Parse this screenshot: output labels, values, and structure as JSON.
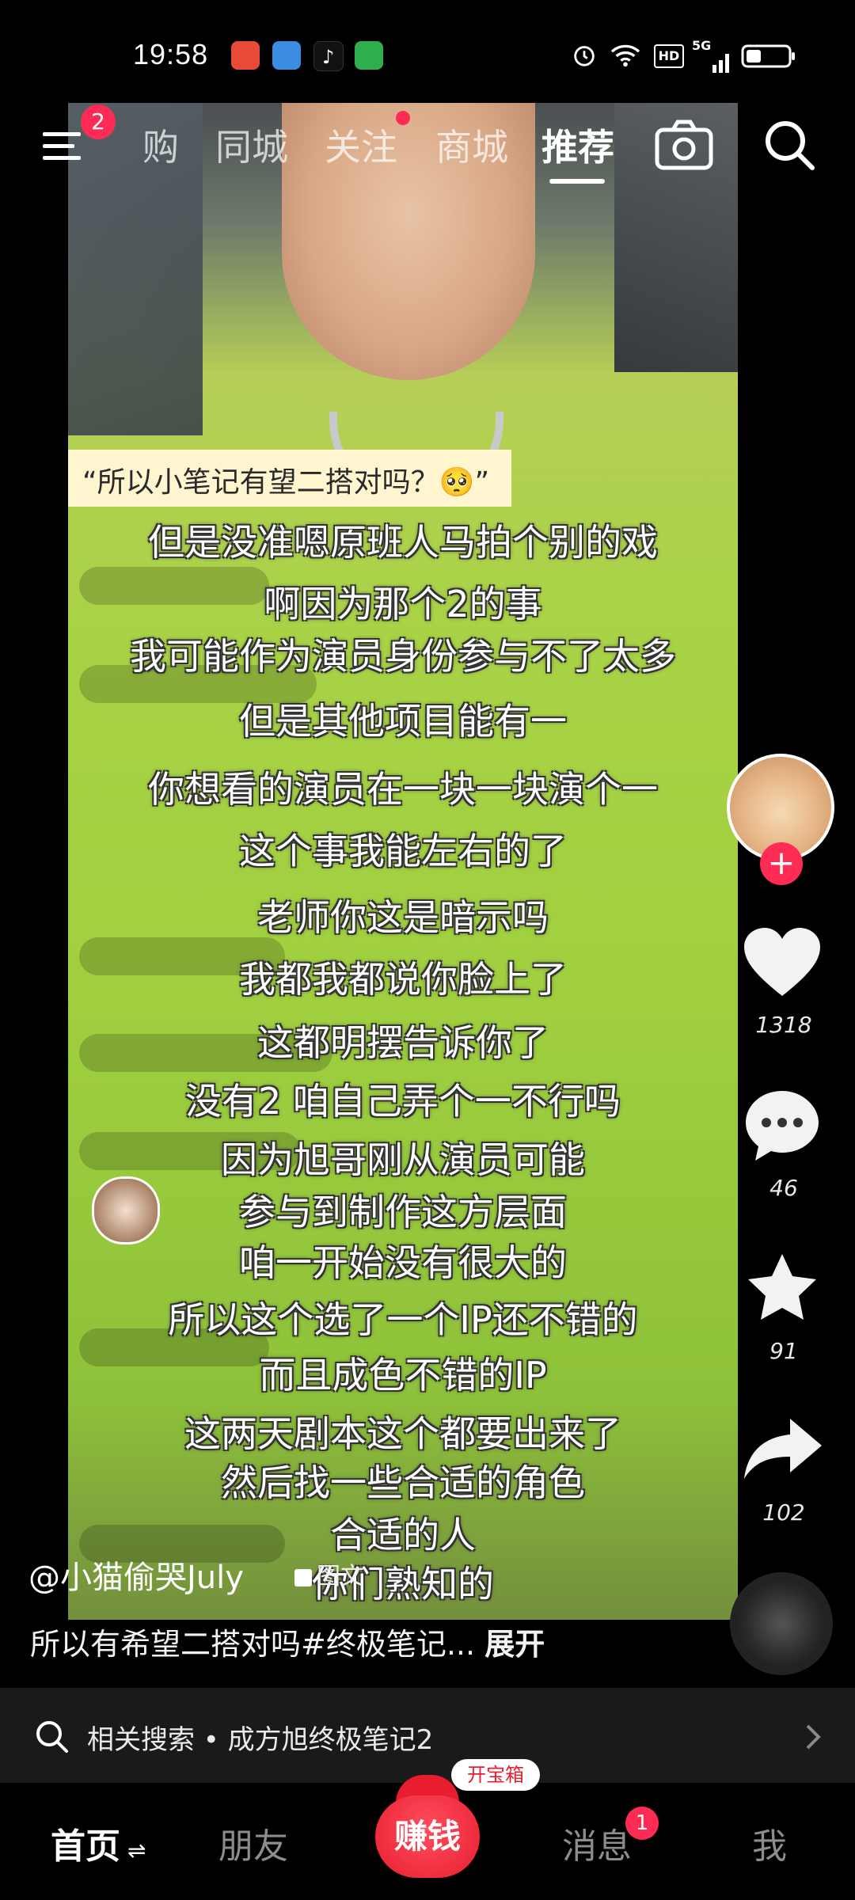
{
  "status_bar": {
    "time": "19:58",
    "network": "5G",
    "hd": "HD"
  },
  "header": {
    "menu_badge": "2",
    "tabs": [
      {
        "label": "购"
      },
      {
        "label": "同城"
      },
      {
        "label": "关注"
      },
      {
        "label": "商城"
      },
      {
        "label": "推荐"
      }
    ]
  },
  "video": {
    "caption_tag": "“所以小笔记有望二搭对吗？🥺”",
    "subtitles": [
      "但是没准嗯原班人马拍个别的戏",
      "啊因为那个2的事",
      "我可能作为演员身份参与不了太多",
      "但是其他项目能有一",
      "你想看的演员在一块一块演个一",
      "这个事我能左右的了",
      "老师你这是暗示吗",
      "我都我都说你脸上了",
      "这都明摆告诉你了",
      "没有2 咱自己弄个一不行吗",
      "因为旭哥刚从演员可能",
      "参与到制作这方层面",
      "咱一开始没有很大的",
      "所以这个选了一个IP还不错的",
      "而且成色不错的IP",
      "这两天剧本这个都要出来了",
      "然后找一些合适的角色",
      "合适的人",
      "你们熟知的"
    ]
  },
  "rail": {
    "likes": "1318",
    "comments": "46",
    "favorites": "91",
    "shares": "102"
  },
  "post": {
    "author": "@小猫偷哭July",
    "type_tag": "图文",
    "description": "所以有希望二搭对吗#终极笔记...",
    "expand": "展开"
  },
  "related": {
    "text": "相关搜索 • 成方旭终极笔记2"
  },
  "bottom_nav": {
    "home": "首页",
    "friends": "朋友",
    "earn": "赚钱",
    "treasure": "开宝箱",
    "messages": "消息",
    "messages_badge": "1",
    "me": "我"
  },
  "colors": {
    "accent": "#fe2c55",
    "background": "#000000"
  }
}
